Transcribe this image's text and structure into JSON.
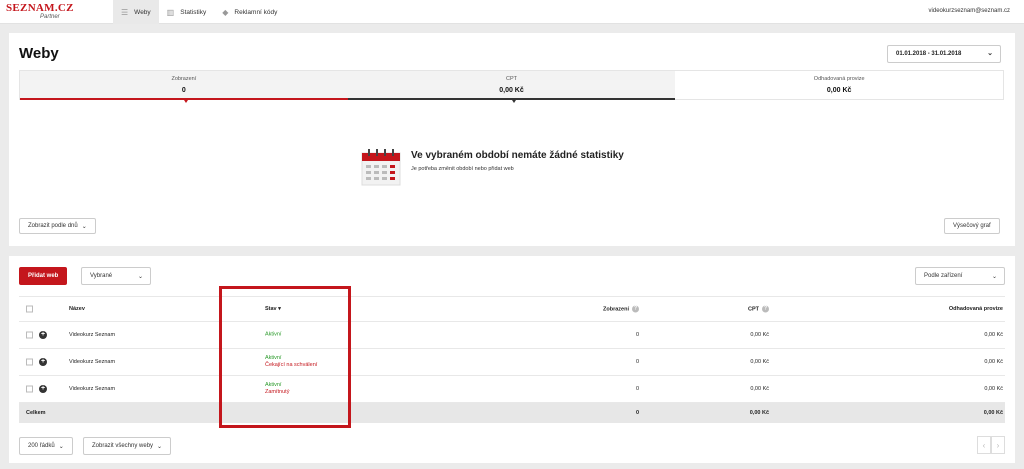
{
  "topbar": {
    "logo_main": "SEZNAM.CZ",
    "logo_sub": "Partner",
    "nav": [
      {
        "label": "Weby",
        "icon": "list-icon"
      },
      {
        "label": "Statistiky",
        "icon": "bar-chart-icon"
      },
      {
        "label": "Reklamní kódy",
        "icon": "tag-icon"
      }
    ],
    "user_email": "videokurzseznam@seznam.cz"
  },
  "stats": {
    "title": "Weby",
    "date_range": "01.01.2018 - 31.01.2018",
    "metrics": [
      {
        "label": "Zobrazení",
        "value": "0"
      },
      {
        "label": "CPT",
        "value": "0,00 Kč"
      },
      {
        "label": "Odhadovaná provize",
        "value": "0,00 Kč"
      }
    ],
    "empty_title": "Ve vybraném období nemáte žádné statistiky",
    "empty_sub": "Je potřeba změnit období nebo přidat web",
    "by_days_label": "Zobrazit podle dnů",
    "pie_label": "Výsečový graf"
  },
  "list": {
    "add_label": "Přidat web",
    "selected_label": "Vybrané",
    "device_label": "Podle zařízení",
    "columns": {
      "name": "Název",
      "stav": "Stav",
      "zobrazeni": "Zobrazení",
      "cpt": "CPT",
      "odhad": "Odhadovaná provize"
    },
    "rows": [
      {
        "name": "Videokurz Seznam",
        "stav1": "Aktivní",
        "stav2": "",
        "zobrazeni": "0",
        "cpt": "0,00 Kč",
        "odhad": "0,00 Kč"
      },
      {
        "name": "Videokurz Seznam",
        "stav1": "Aktivní",
        "stav2": "Čekající na schválení",
        "zobrazeni": "0",
        "cpt": "0,00 Kč",
        "odhad": "0,00 Kč"
      },
      {
        "name": "Videokurz Seznam",
        "stav1": "Aktivní",
        "stav2": "Zamítnutý",
        "zobrazeni": "0",
        "cpt": "0,00 Kč",
        "odhad": "0,00 Kč"
      }
    ],
    "total": {
      "label": "Celkem",
      "zobrazeni": "0",
      "cpt": "0,00 Kč",
      "odhad": "0,00 Kč"
    },
    "rows_per_page": "200 řádků",
    "show_all": "Zobrazit všechny weby"
  },
  "colors": {
    "accent": "#c4161c",
    "active": "#2a9a2a"
  }
}
